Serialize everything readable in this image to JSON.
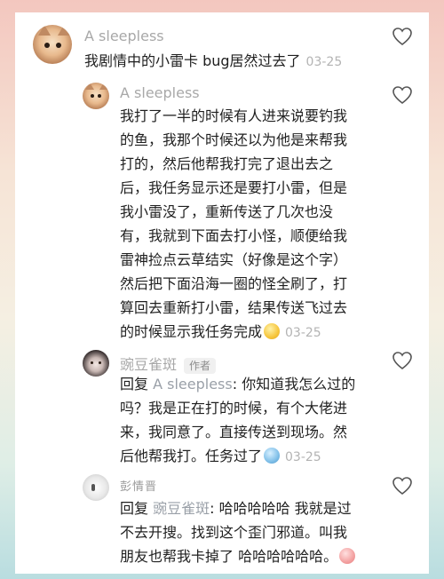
{
  "comments": [
    {
      "username": "A sleepless",
      "text": "我剧情中的小雷卡 bug居然过去了",
      "date": "03-25",
      "avatar_icon": "cat-avatar"
    },
    {
      "username": "A sleepless",
      "lines": [
        "我打了一半的时候有人进来说要钓我",
        "的鱼，我那个时候还以为他是来帮我",
        "打的，然后他帮我打完了退出去之",
        "后，我任务显示还是要打小雷，但是",
        "我小雷没了，重新传送了几次也没",
        "有，我就到下面去打小怪，顺便给我",
        "雷神捡点云草结实（好像是这个字）",
        "然后把下面沿海一圈的怪全刷了，打",
        "算回去重新打小雷，结果传送飞过去",
        "的时候显示我任务完成"
      ],
      "date": "03-25",
      "emoji": "laughing-emoji",
      "avatar_icon": "cat-avatar"
    },
    {
      "username": "豌豆雀斑",
      "author_tag": "作者",
      "reply_prefix": "回复 ",
      "mention": "A sleepless",
      "line1_rest": ": 你知道我怎么过的",
      "lines": [
        "吗？我是正在打的时候，有个大佬进",
        "来，我同意了。直接传送到现场。然"
      ],
      "last_line": "后他帮我打。任务过了",
      "date": "03-25",
      "emoji": "crying-emoji",
      "avatar_icon": "girl-avatar"
    },
    {
      "username": "彭情晋",
      "reply_prefix": "回复 ",
      "mention": "豌豆雀斑",
      "line1_rest": ": 哈哈哈哈哈 我就是过",
      "lines": [
        "不去开搜。找到这个歪门邪道。叫我",
        "朋友也帮我卡掉了 哈哈哈哈哈哈。"
      ],
      "emoji": "pig-emoji",
      "avatar_icon": "sketch-avatar"
    }
  ],
  "colors": {
    "background_top": "#f3c7bf",
    "background_bottom": "#b9dde0",
    "text": "#1f1f1f",
    "muted": "#a8a8a8"
  }
}
